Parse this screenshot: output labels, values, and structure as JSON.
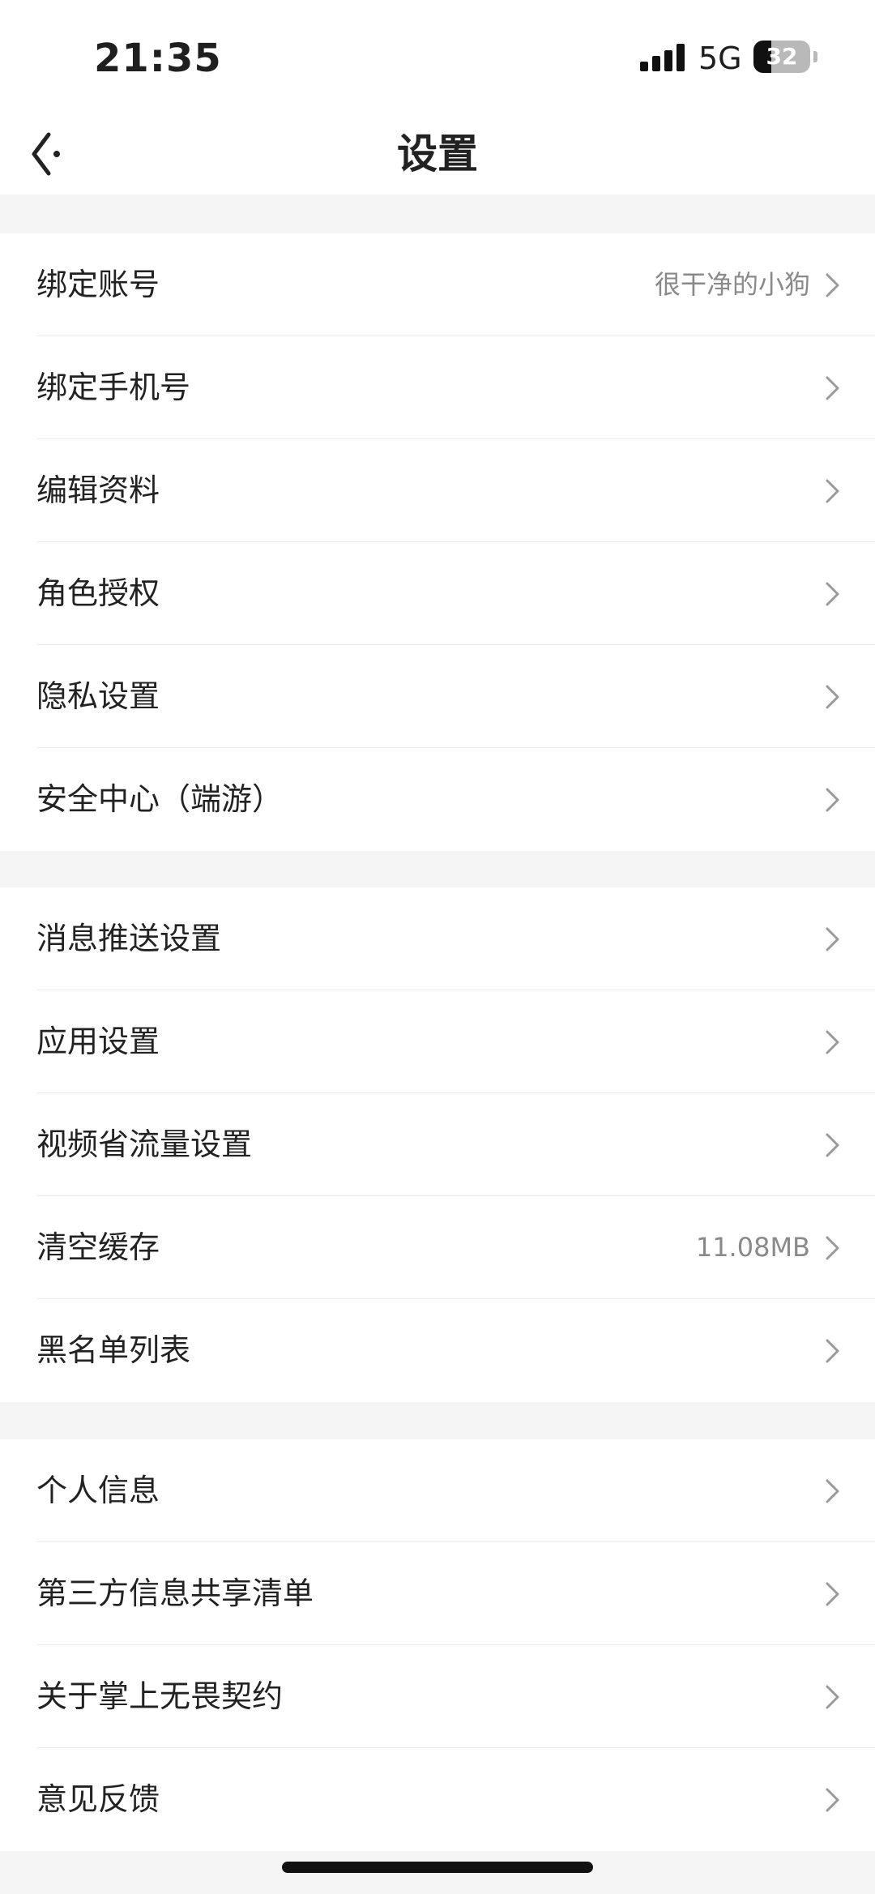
{
  "status_bar": {
    "time": "21:35",
    "network": "5G",
    "battery": "32",
    "battery_level_percent": 32
  },
  "header": {
    "title": "设置",
    "back_icon": "back-arrow-icon"
  },
  "groups": [
    {
      "items": [
        {
          "label": "绑定账号",
          "value": "很干净的小狗"
        },
        {
          "label": "绑定手机号",
          "value": ""
        },
        {
          "label": "编辑资料",
          "value": ""
        },
        {
          "label": "角色授权",
          "value": ""
        },
        {
          "label": "隐私设置",
          "value": ""
        },
        {
          "label": "安全中心（端游）",
          "value": ""
        }
      ]
    },
    {
      "items": [
        {
          "label": "消息推送设置",
          "value": ""
        },
        {
          "label": "应用设置",
          "value": ""
        },
        {
          "label": "视频省流量设置",
          "value": ""
        },
        {
          "label": "清空缓存",
          "value": "11.08MB"
        },
        {
          "label": "黑名单列表",
          "value": ""
        }
      ]
    },
    {
      "items": [
        {
          "label": "个人信息",
          "value": ""
        },
        {
          "label": "第三方信息共享清单",
          "value": ""
        },
        {
          "label": "关于掌上无畏契约",
          "value": ""
        },
        {
          "label": "意见反馈",
          "value": ""
        }
      ]
    }
  ],
  "colors": {
    "background": "#f5f5f5",
    "row_background": "#ffffff",
    "text": "#222222",
    "secondary_text": "#8a8a8a",
    "chevron": "#9a9a9a"
  },
  "icons": {
    "row_chevron": "chevron-right-icon"
  }
}
